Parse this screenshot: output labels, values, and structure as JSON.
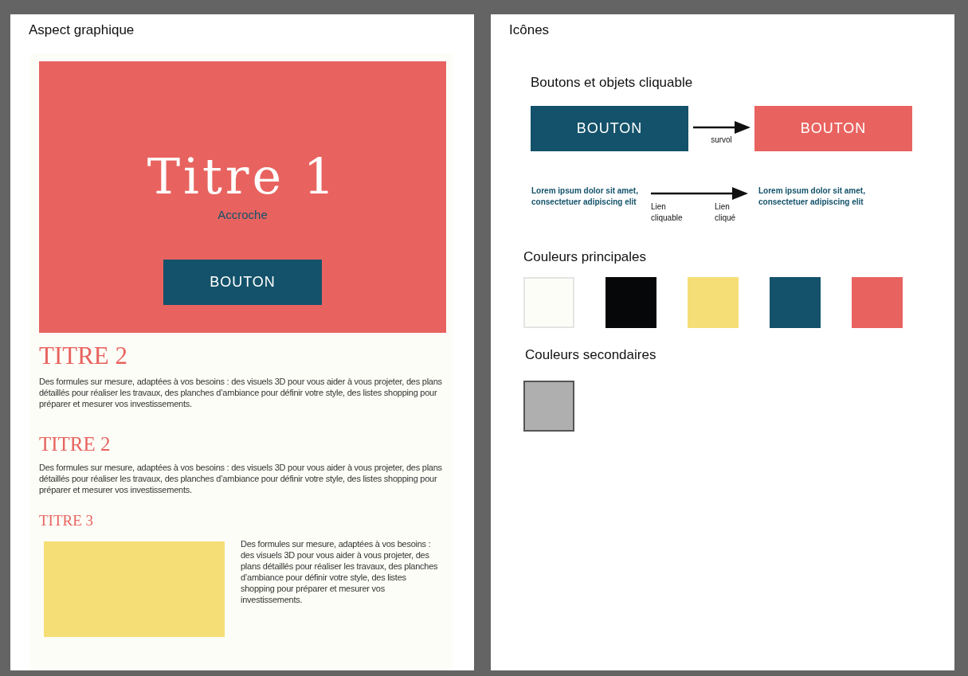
{
  "left_page": {
    "title": "Aspect graphique",
    "hero": {
      "title": "Titre 1",
      "tagline": "Accroche",
      "button": "BOUTON"
    },
    "sections": [
      {
        "kind": "h2",
        "heading": "TITRE 2",
        "text": "Des formules sur mesure, adaptées à vos besoins : des visuels 3D pour vous aider à vous projeter, des plans détaillés pour réaliser les travaux, des planches d’ambiance pour définir votre style, des listes shopping pour préparer et mesurer vos investissements."
      },
      {
        "kind": "h2small",
        "heading": "TITRE 2",
        "text": "Des formules sur mesure, adaptées à vos besoins : des visuels 3D pour vous aider à vous projeter, des plans détaillés pour réaliser les travaux, des planches d’ambiance pour définir votre style, des listes shopping pour préparer et mesurer vos investissements."
      },
      {
        "kind": "h3",
        "heading": "TITRE 3",
        "text": "Des formules sur mesure, adaptées à vos besoins : des visuels 3D pour vous aider à vous projeter, des plans détaillés pour réaliser les travaux, des planches d’ambiance pour définir votre style, des listes shopping pour préparer et mesurer vos investissements."
      }
    ]
  },
  "right_page": {
    "title": "Icônes",
    "buttons_section": {
      "heading": "Boutons et objets cliquable",
      "button_default": {
        "label": "BOUTON",
        "color": "#13526a"
      },
      "arrow_label": "survol",
      "button_hover": {
        "label": "BOUTON",
        "color": "#e8635f"
      },
      "link_default": "Lorem ipsum dolor sit amet, consectetuer adipiscing elit",
      "link_from_label": "Lien cliquable",
      "link_to_label": "Lien cliqué",
      "link_clicked": "Lorem ipsum dolor sit amet, consectetuer adipiscing elit"
    },
    "primary_colors": {
      "heading": "Couleurs principales",
      "swatches": [
        {
          "color": "#fdfdf7"
        },
        {
          "color": "#060709"
        },
        {
          "color": "#f6de77"
        },
        {
          "color": "#13526a"
        },
        {
          "color": "#e8635f"
        }
      ]
    },
    "secondary_colors": {
      "heading": "Couleurs secondaires",
      "swatches": [
        {
          "color": "#afafaf"
        }
      ]
    }
  }
}
